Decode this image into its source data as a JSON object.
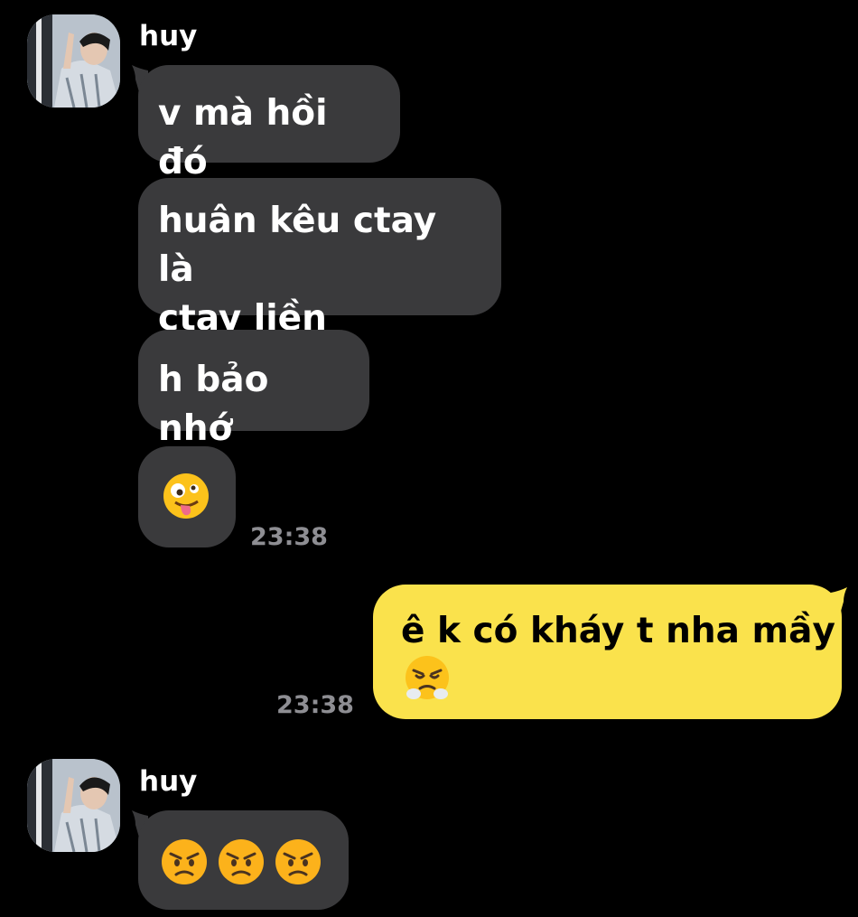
{
  "conversation": {
    "groups": [
      {
        "sender": "huy",
        "messages": [
          {
            "text": "v mà hồi đó"
          },
          {
            "line1": "huân kêu ctay là",
            "line2": "ctay liền"
          },
          {
            "text": "h bảo nhớ"
          },
          {
            "emoji": "zany-face"
          }
        ],
        "time": "23:38"
      },
      {
        "sender": "me",
        "messages": [
          {
            "text": "ê k có kháy t nha mầy",
            "emoji": "face-with-steam-from-nose"
          }
        ],
        "time": "23:38"
      },
      {
        "sender": "huy",
        "messages": [
          {
            "emojis": [
              "angry-face",
              "angry-face",
              "angry-face"
            ]
          }
        ]
      }
    ]
  },
  "colors": {
    "background": "#000000",
    "incoming_bubble": "#3a3a3c",
    "outgoing_bubble": "#fae24c",
    "timestamp": "#8e8e93"
  }
}
